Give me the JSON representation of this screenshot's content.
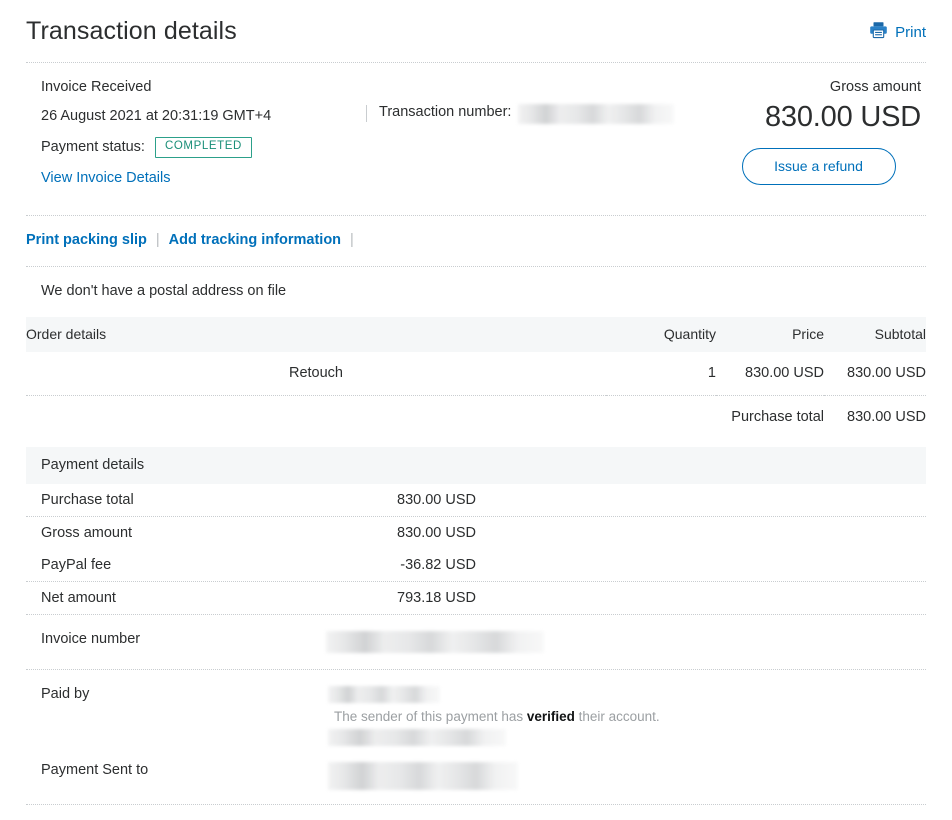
{
  "header": {
    "title": "Transaction details",
    "print_label": "Print",
    "print_icon": "printer-icon"
  },
  "summary": {
    "invoice_status_text": "Invoice Received",
    "datetime": "26 August 2021 at 20:31:19 GMT+4",
    "payment_status_label": "Payment status:",
    "payment_status_value": "COMPLETED",
    "view_invoice_link": "View Invoice Details",
    "transaction_number_label": "Transaction number:",
    "transaction_number_value": "",
    "gross_amount_label": "Gross amount",
    "gross_amount_value": "830.00 USD",
    "refund_button_label": "Issue a refund"
  },
  "actions": {
    "print_packing_slip": "Print packing slip",
    "add_tracking_information": "Add tracking information",
    "separator": "|"
  },
  "postal_note": "We don't have a postal address on file",
  "order_table": {
    "columns": [
      "Order details",
      "Quantity",
      "Price",
      "Subtotal"
    ],
    "rows": [
      {
        "details": "Retouch",
        "quantity": "1",
        "price": "830.00 USD",
        "subtotal": "830.00 USD"
      }
    ],
    "total_label": "Purchase total",
    "total_value": "830.00 USD"
  },
  "payment_details": {
    "section_title": "Payment details",
    "rows": [
      {
        "label": "Purchase total",
        "value": "830.00 USD"
      },
      {
        "label": "Gross amount",
        "value": "830.00 USD"
      },
      {
        "label": "PayPal fee",
        "value": "-36.82 USD"
      },
      {
        "label": "Net amount",
        "value": "793.18 USD"
      }
    ],
    "invoice_number_label": "Invoice number",
    "invoice_number_value": "",
    "paid_by_label": "Paid by",
    "paid_by_value": "",
    "verified_prefix": "The sender of this payment has ",
    "verified_word": "verified",
    "verified_suffix": " their account.",
    "paid_by_email": "",
    "payment_sent_to_label": "Payment Sent to",
    "payment_sent_to_value": ""
  },
  "colors": {
    "link_blue": "#0070ba",
    "status_green": "#1a8f78",
    "text": "#2c2e2f",
    "band_gray": "#f5f7f8",
    "rule": "#c9cdd0"
  }
}
